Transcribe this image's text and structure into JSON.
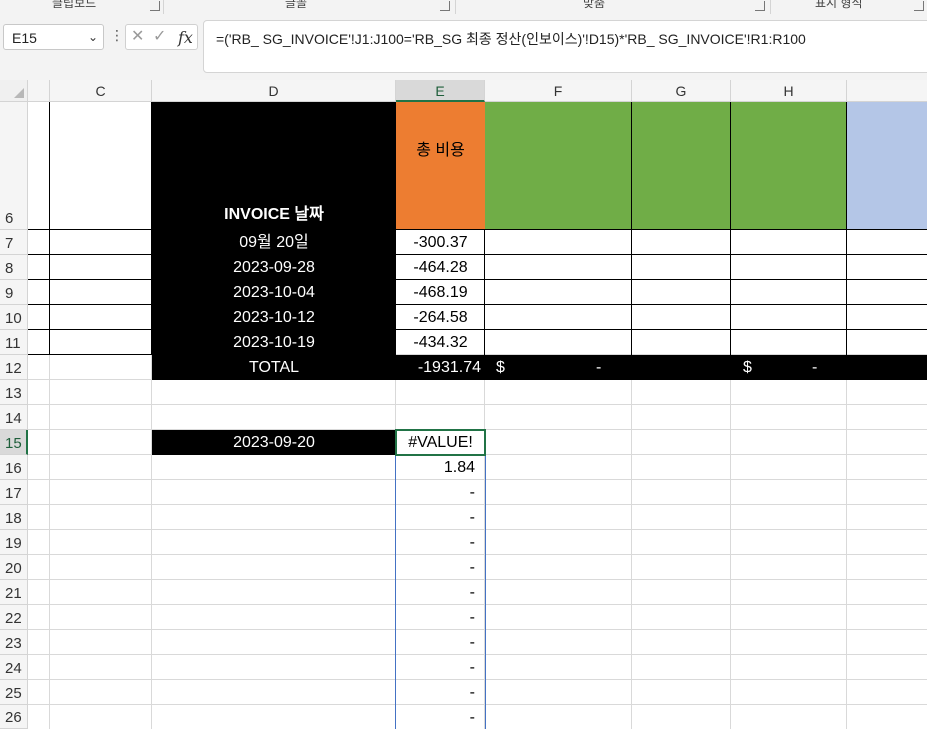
{
  "ribbon": {
    "groups": [
      {
        "label": "클립보드"
      },
      {
        "label": "글꼴"
      },
      {
        "label": "맞춤"
      },
      {
        "label": "표시 형식"
      }
    ]
  },
  "formula_bar": {
    "name_box": "E15",
    "cancel_symbol": "✕",
    "enter_symbol": "✓",
    "fx_label": "fx",
    "formula": "=('RB_ SG_INVOICE'!J1:J100='RB_SG 최종 정산(인보이스)'!D15)*'RB_ SG_INVOICE'!R1:R100"
  },
  "columns": [
    "C",
    "D",
    "E",
    "F",
    "G",
    "H"
  ],
  "selected_column": "E",
  "rows": [
    "6",
    "7",
    "8",
    "9",
    "10",
    "11",
    "12",
    "13",
    "14",
    "15",
    "16",
    "17",
    "18",
    "19",
    "20",
    "21",
    "22",
    "23",
    "24",
    "25",
    "26"
  ],
  "selected_row": "15",
  "sheet": {
    "header_d": "INVOICE 날짜",
    "header_e": "총 비용",
    "dates": [
      "09월 20일",
      "2023-09-28",
      "2023-10-04",
      "2023-10-12",
      "2023-10-19"
    ],
    "costs": [
      "-300.37",
      "-464.28",
      "-468.19",
      "-264.58",
      "-434.32"
    ],
    "total_label": "TOTAL",
    "total_value": "-1931.74",
    "total_f_currency": "$",
    "total_f_value": "-",
    "total_h_currency": "$",
    "total_h_value": "-",
    "lookup_date": "2023-09-20",
    "lookup_result": "#VALUE!",
    "spill_values": [
      "1.84",
      "-",
      "-",
      "-",
      "-",
      "-",
      "-",
      "-",
      "-",
      "-",
      "-"
    ]
  },
  "colors": {
    "black_fill": "#000000",
    "orange_fill": "#ed7d31",
    "green_fill": "#70ad47",
    "blue_fill": "#b4c6e7",
    "selection": "#217346",
    "spill_border": "#4472c4"
  }
}
